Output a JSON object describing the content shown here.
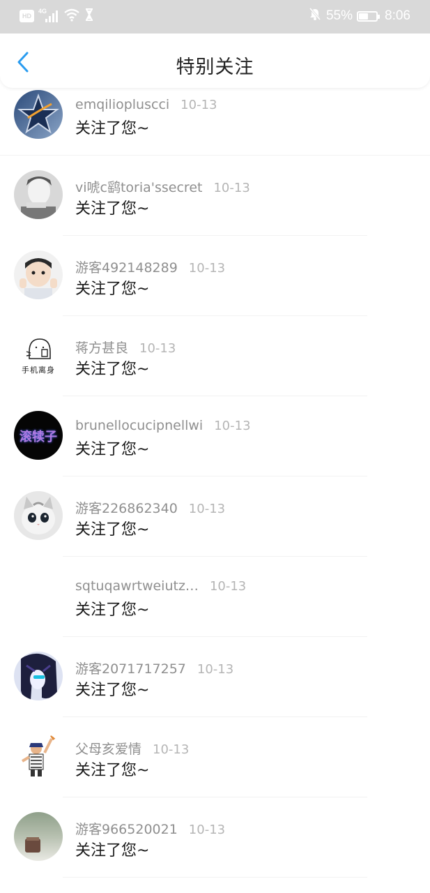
{
  "status_bar": {
    "hd": "HD",
    "network": "4G",
    "battery_percent": "55%",
    "battery_level": 0.55,
    "time": "8:06",
    "icons": [
      "hd-icon",
      "signal-icon",
      "wifi-icon",
      "hourglass-icon",
      "mute-bell-icon",
      "battery-icon"
    ]
  },
  "header": {
    "title": "特别关注",
    "back_icon": "chevron-left-icon",
    "accent_color": "#2a9cf0"
  },
  "items": [
    {
      "name": "emqilioplusсci",
      "date": "10-13",
      "message": "关注了您~",
      "avatar": "star-logo"
    },
    {
      "name": "vi唬c鹞toria'ssecret",
      "date": "10-13",
      "message": "关注了您~",
      "avatar": "bw-portrait"
    },
    {
      "name": "游客492148289",
      "date": "10-13",
      "message": "关注了您~",
      "avatar": "child-photo"
    },
    {
      "name": "蒋方甚良",
      "date": "10-13",
      "message": "关注了您~",
      "avatar": "sticker-text",
      "avatar_text": "手机离身"
    },
    {
      "name": "brunellocucipnellwi",
      "date": "10-13",
      "message": "关注了您~",
      "avatar": "dark-text",
      "avatar_text": "滚犊子"
    },
    {
      "name": "游客226862340",
      "date": "10-13",
      "message": "关注了您~",
      "avatar": "cat-photo"
    },
    {
      "name": "sqtuqawrtweiutz…",
      "date": "10-13",
      "message": "关注了您~",
      "avatar": "blank"
    },
    {
      "name": "游客2071717257",
      "date": "10-13",
      "message": "关注了您~",
      "avatar": "anime-photo"
    },
    {
      "name": "父母亥爱情",
      "date": "10-13",
      "message": "关注了您~",
      "avatar": "cartoon-figure"
    },
    {
      "name": "游客966520021",
      "date": "10-13",
      "message": "关注了您~",
      "avatar": "blurred-photo"
    }
  ]
}
